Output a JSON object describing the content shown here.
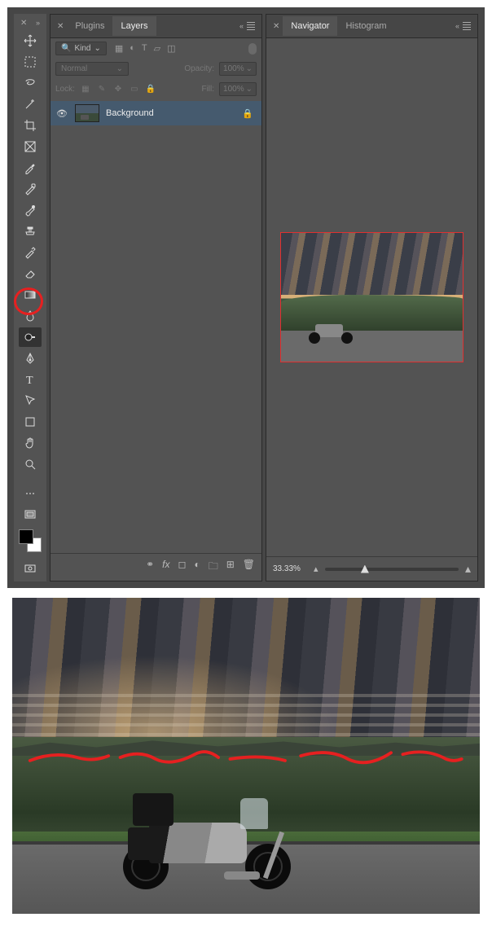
{
  "toolbar": {
    "close": "✕",
    "collapse": "»"
  },
  "layersPanel": {
    "tabs": {
      "plugins": "Plugins",
      "layers": "Layers"
    },
    "kindLabel": "Kind",
    "blendMode": "Normal",
    "opacityLabel": "Opacity:",
    "opacityValue": "100%",
    "lockLabel": "Lock:",
    "fillLabel": "Fill:",
    "fillValue": "100%",
    "layer": {
      "name": "Background"
    }
  },
  "navPanel": {
    "tabs": {
      "navigator": "Navigator",
      "histogram": "Histogram"
    },
    "zoom": "33.33%"
  }
}
